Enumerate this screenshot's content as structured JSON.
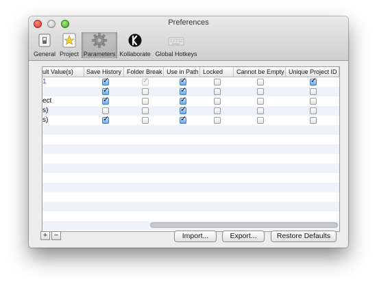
{
  "window": {
    "title": "Preferences"
  },
  "toolbar": {
    "items": [
      {
        "label": "General",
        "icon": "switch-icon"
      },
      {
        "label": "Project",
        "icon": "project-star-icon"
      },
      {
        "label": "Parameters",
        "icon": "gear-icon",
        "selected": true
      },
      {
        "label": "Kollaborate",
        "icon": "kollaborate-icon"
      },
      {
        "label": "Global Hotkeys",
        "icon": "keyboard-icon"
      }
    ]
  },
  "table": {
    "columns": [
      "ult Value(s)",
      "Save History",
      "Folder Break",
      "Use in Path",
      "Locked",
      "Cannot be Empty",
      "Unique Project ID"
    ],
    "rows": [
      {
        "value": "1",
        "save_history": true,
        "folder_break": true,
        "folder_break_disabled": true,
        "use_in_path": true,
        "locked": false,
        "cannot_be_empty": false,
        "unique_project_id": true
      },
      {
        "value": "",
        "save_history": true,
        "folder_break": false,
        "use_in_path": true,
        "locked": false,
        "cannot_be_empty": false,
        "unique_project_id": false
      },
      {
        "value": "ect",
        "save_history": true,
        "folder_break": false,
        "use_in_path": true,
        "locked": false,
        "cannot_be_empty": false,
        "unique_project_id": false
      },
      {
        "value": "s)",
        "save_history": false,
        "folder_break": false,
        "use_in_path": true,
        "locked": false,
        "cannot_be_empty": false,
        "unique_project_id": false
      },
      {
        "value": "s)",
        "save_history": true,
        "folder_break": false,
        "use_in_path": true,
        "locked": false,
        "cannot_be_empty": false,
        "unique_project_id": false
      }
    ]
  },
  "footer": {
    "add": "+",
    "remove": "−",
    "import": "Import...",
    "export": "Export...",
    "restore": "Restore Defaults"
  },
  "colors": {
    "row_alt": "#eef3fb",
    "checkbox_on": "#6aa7e8",
    "close": "#d8342c",
    "minimize": "#b9b9b9",
    "zoom": "#3d9f22"
  }
}
